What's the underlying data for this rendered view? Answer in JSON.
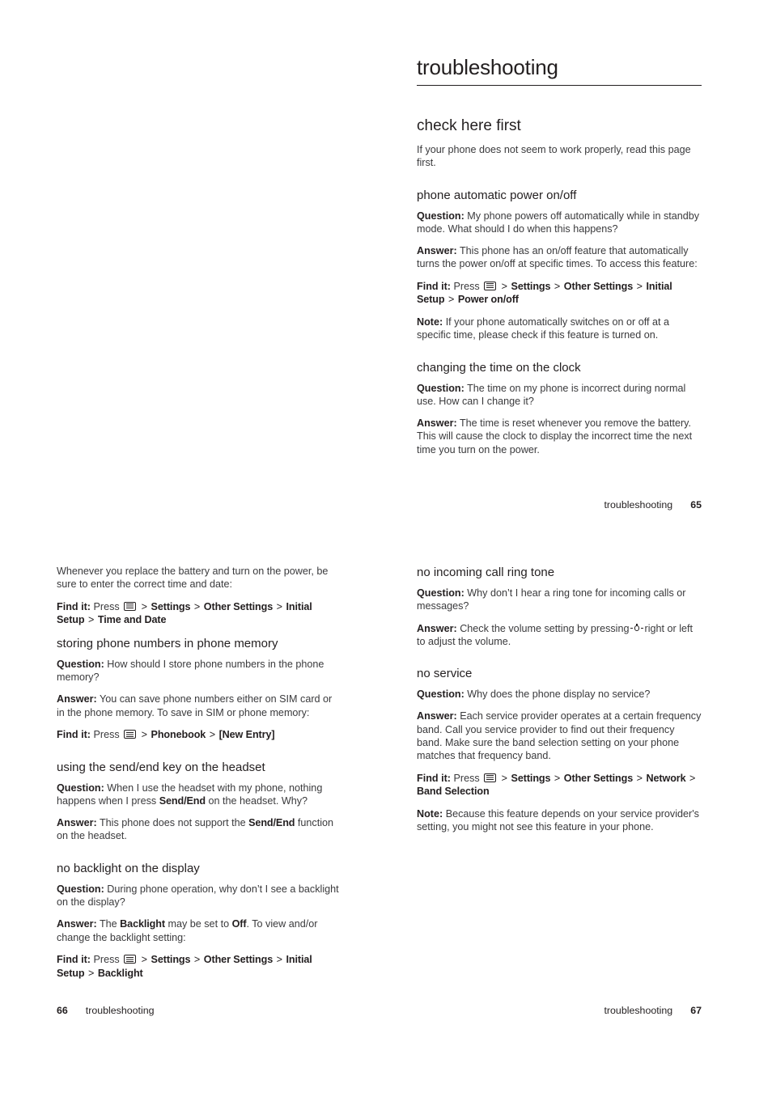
{
  "document": {
    "title": "troubleshooting",
    "section_footer_label": "troubleshooting"
  },
  "icons": {
    "menu_key": "menu-key-icon",
    "nav_key": "navigation-key-icon"
  },
  "labels": {
    "question": "Question:",
    "answer": "Answer:",
    "note": "Note:",
    "find_it": "Find it:",
    "press": "Press",
    "separator": ">"
  },
  "page_65": {
    "number": "65",
    "footer_label": "troubleshooting",
    "heading": "check here first",
    "intro": "If your phone does not seem to work properly, read this page first.",
    "sections": [
      {
        "heading": "phone automatic power on/off",
        "question": "My phone powers off automatically while in standby mode. What should I do when this happens?",
        "answer": "This phone has an on/off feature that automatically turns the power on/off at specific times. To access this feature:",
        "find_it_path": [
          "Settings",
          "Other Settings",
          "Initial Setup",
          "Power on/off"
        ],
        "note": "If your phone automatically switches on or off at a specific time, please check if this feature is turned on."
      },
      {
        "heading": "changing the time on the clock",
        "question": "The time on my phone is incorrect during normal use. How can I change it?",
        "answer": "The time is reset whenever you remove the battery. This will cause the clock to display the incorrect time the next time you turn on the power."
      }
    ]
  },
  "page_66": {
    "number": "66",
    "footer_label": "troubleshooting",
    "continuation_text": "Whenever you replace the battery and turn on the power, be sure to enter the correct time and date:",
    "continuation_find_it_path": [
      "Settings",
      "Other Settings",
      "Initial Setup",
      "Time and Date"
    ],
    "sections": [
      {
        "heading": "storing phone numbers in phone memory",
        "question": "How should I store phone numbers in the phone memory?",
        "answer": "You can save phone numbers either on SIM card or in the phone memory. To save in SIM or phone memory:",
        "find_it_path": [
          "Phonebook",
          "[New Entry]"
        ]
      },
      {
        "heading": "using the send/end key on the headset",
        "question_parts": [
          {
            "text": "When I use the headset with my phone, nothing happens when I press ",
            "style": "normal"
          },
          {
            "text": "Send/End",
            "style": "condensed-bold"
          },
          {
            "text": " on the headset. Why?",
            "style": "normal"
          }
        ],
        "answer_parts": [
          {
            "text": "This phone does not support the ",
            "style": "normal"
          },
          {
            "text": "Send/End",
            "style": "condensed-bold"
          },
          {
            "text": " function on the headset.",
            "style": "normal"
          }
        ]
      },
      {
        "heading": "no backlight on the display",
        "question": "During phone operation, why don’t I see a backlight on the display?",
        "answer_parts": [
          {
            "text": "The ",
            "style": "normal"
          },
          {
            "text": "Backlight",
            "style": "condensed-bold"
          },
          {
            "text": " may be set to ",
            "style": "normal"
          },
          {
            "text": "Off",
            "style": "condensed-bold"
          },
          {
            "text": ". To view and/or change the backlight setting:",
            "style": "normal"
          }
        ],
        "find_it_path": [
          "Settings",
          "Other Settings",
          "Initial Setup",
          "Backlight"
        ]
      }
    ]
  },
  "page_67": {
    "number": "67",
    "footer_label": "troubleshooting",
    "sections": [
      {
        "heading": "no incoming call ring tone",
        "question": "Why don’t I hear a ring tone for incoming calls or messages?",
        "answer_before_icon": "Check the volume setting by pressing",
        "answer_after_icon": "right or left to adjust the volume."
      },
      {
        "heading": "no service",
        "question": "Why does the phone display no service?",
        "answer": "Each service provider operates at a certain frequency band. Call you service provider to find out their frequency band. Make sure the band selection setting on your phone matches that frequency band.",
        "find_it_path": [
          "Settings",
          "Other Settings",
          "Network",
          "Band Selection"
        ],
        "note": "Because this feature depends on your service provider's setting, you might not see this feature in your phone."
      }
    ]
  }
}
